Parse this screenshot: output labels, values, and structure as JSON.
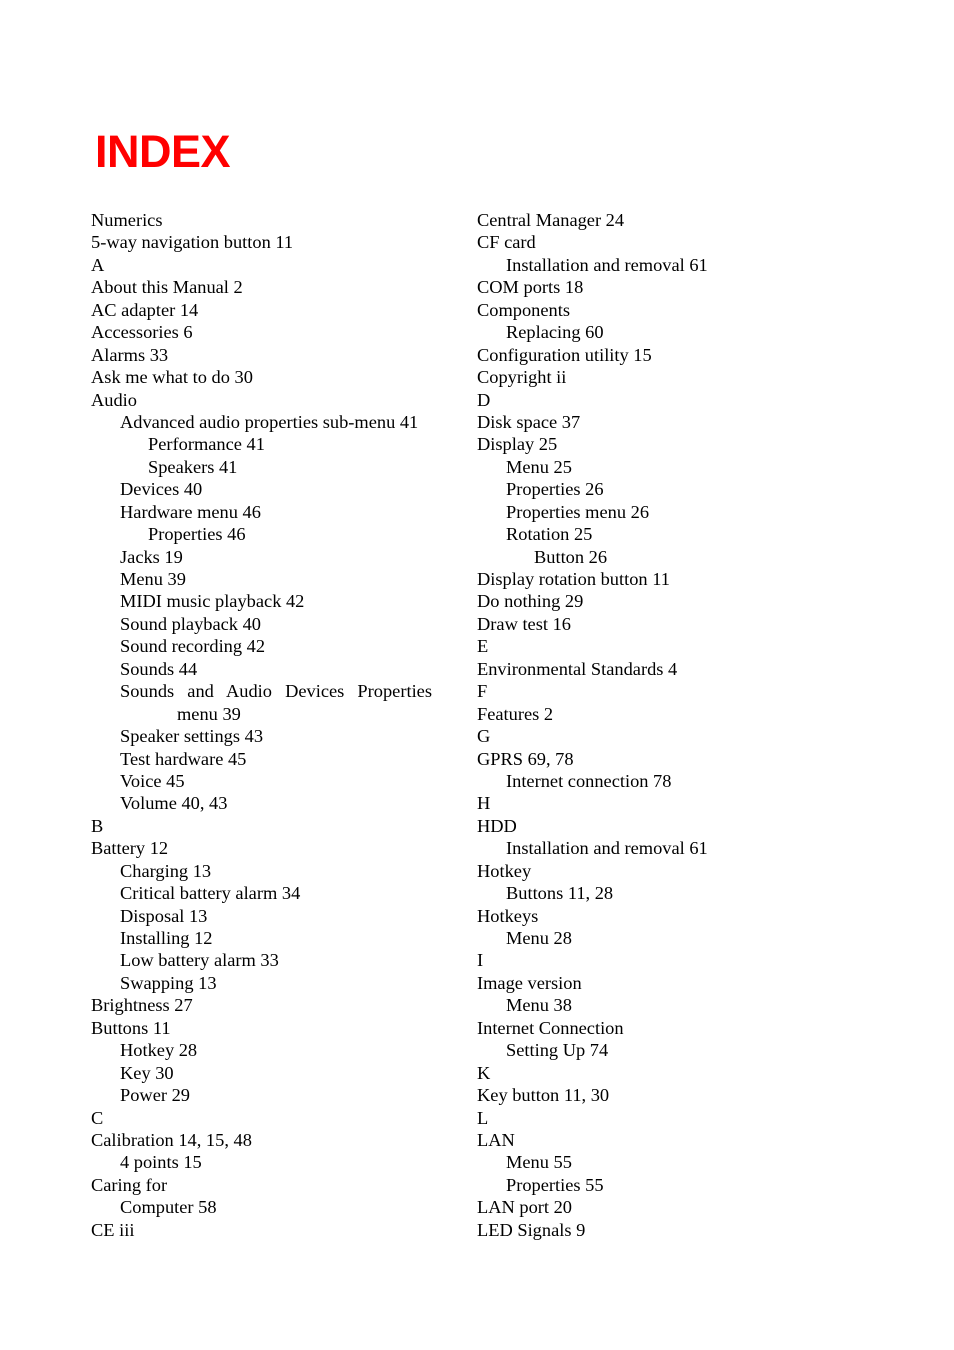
{
  "page": {
    "title": "INDEX",
    "title_color": "#FF0000"
  },
  "index": {
    "left_column": [
      {
        "text": "Numerics",
        "level": 0,
        "kind": "letter"
      },
      {
        "text": "5-way navigation button 11",
        "level": 0,
        "kind": "entry"
      },
      {
        "text": "A",
        "level": 0,
        "kind": "letter"
      },
      {
        "text": "About this Manual 2",
        "level": 0,
        "kind": "entry"
      },
      {
        "text": "AC adapter 14",
        "level": 0,
        "kind": "entry"
      },
      {
        "text": "Accessories 6",
        "level": 0,
        "kind": "entry"
      },
      {
        "text": "Alarms 33",
        "level": 0,
        "kind": "entry"
      },
      {
        "text": "Ask me what to do 30",
        "level": 0,
        "kind": "entry"
      },
      {
        "text": "Audio",
        "level": 0,
        "kind": "entry"
      },
      {
        "text": "Advanced audio properties sub-menu 41",
        "level": 1,
        "kind": "entry"
      },
      {
        "text": "Performance 41",
        "level": 2,
        "kind": "entry"
      },
      {
        "text": "Speakers 41",
        "level": 2,
        "kind": "entry"
      },
      {
        "text": "Devices 40",
        "level": 1,
        "kind": "entry"
      },
      {
        "text": "Hardware menu 46",
        "level": 1,
        "kind": "entry"
      },
      {
        "text": "Properties 46",
        "level": 2,
        "kind": "entry"
      },
      {
        "text": "Jacks 19",
        "level": 1,
        "kind": "entry"
      },
      {
        "text": "Menu 39",
        "level": 1,
        "kind": "entry"
      },
      {
        "text": "MIDI music playback 42",
        "level": 1,
        "kind": "entry"
      },
      {
        "text": "Sound playback 40",
        "level": 1,
        "kind": "entry"
      },
      {
        "text": "Sound recording 42",
        "level": 1,
        "kind": "entry"
      },
      {
        "text": "Sounds 44",
        "level": 1,
        "kind": "entry"
      },
      {
        "text": "Sounds and Audio Devices Properties",
        "level": 1,
        "kind": "justified"
      },
      {
        "text": "menu 39",
        "level": 3,
        "kind": "entry"
      },
      {
        "text": "Speaker settings 43",
        "level": 1,
        "kind": "entry"
      },
      {
        "text": "Test hardware 45",
        "level": 1,
        "kind": "entry"
      },
      {
        "text": "Voice 45",
        "level": 1,
        "kind": "entry"
      },
      {
        "text": "Volume 40, 43",
        "level": 1,
        "kind": "entry"
      },
      {
        "text": "B",
        "level": 0,
        "kind": "letter"
      },
      {
        "text": "Battery 12",
        "level": 0,
        "kind": "entry"
      },
      {
        "text": "Charging 13",
        "level": 1,
        "kind": "entry"
      },
      {
        "text": "Critical battery alarm 34",
        "level": 1,
        "kind": "entry"
      },
      {
        "text": "Disposal 13",
        "level": 1,
        "kind": "entry"
      },
      {
        "text": "Installing 12",
        "level": 1,
        "kind": "entry"
      },
      {
        "text": "Low battery alarm 33",
        "level": 1,
        "kind": "entry"
      },
      {
        "text": "Swapping 13",
        "level": 1,
        "kind": "entry"
      },
      {
        "text": "Brightness 27",
        "level": 0,
        "kind": "entry"
      },
      {
        "text": "Buttons 11",
        "level": 0,
        "kind": "entry"
      },
      {
        "text": "Hotkey 28",
        "level": 1,
        "kind": "entry"
      },
      {
        "text": "Key 30",
        "level": 1,
        "kind": "entry"
      },
      {
        "text": "Power 29",
        "level": 1,
        "kind": "entry"
      },
      {
        "text": "C",
        "level": 0,
        "kind": "letter"
      },
      {
        "text": "Calibration 14, 15, 48",
        "level": 0,
        "kind": "entry"
      },
      {
        "text": "4 points 15",
        "level": 1,
        "kind": "entry"
      },
      {
        "text": "Caring for",
        "level": 0,
        "kind": "entry"
      },
      {
        "text": "Computer 58",
        "level": 1,
        "kind": "entry"
      },
      {
        "text": "CE iii",
        "level": 0,
        "kind": "entry"
      }
    ],
    "right_column": [
      {
        "text": "Central Manager 24",
        "level": 0,
        "kind": "entry"
      },
      {
        "text": "CF card",
        "level": 0,
        "kind": "entry"
      },
      {
        "text": "Installation and removal 61",
        "level": 1,
        "kind": "entry"
      },
      {
        "text": "COM ports 18",
        "level": 0,
        "kind": "entry"
      },
      {
        "text": "Components",
        "level": 0,
        "kind": "entry"
      },
      {
        "text": "Replacing 60",
        "level": 1,
        "kind": "entry"
      },
      {
        "text": "Configuration utility 15",
        "level": 0,
        "kind": "entry"
      },
      {
        "text": "Copyright ii",
        "level": 0,
        "kind": "entry"
      },
      {
        "text": "D",
        "level": 0,
        "kind": "letter"
      },
      {
        "text": "Disk space 37",
        "level": 0,
        "kind": "entry"
      },
      {
        "text": "Display 25",
        "level": 0,
        "kind": "entry"
      },
      {
        "text": "Menu 25",
        "level": 1,
        "kind": "entry"
      },
      {
        "text": "Properties 26",
        "level": 1,
        "kind": "entry"
      },
      {
        "text": "Properties menu 26",
        "level": 1,
        "kind": "entry"
      },
      {
        "text": "Rotation 25",
        "level": 1,
        "kind": "entry"
      },
      {
        "text": "Button 26",
        "level": 2,
        "kind": "entry"
      },
      {
        "text": "Display rotation button 11",
        "level": 0,
        "kind": "entry"
      },
      {
        "text": "Do nothing 29",
        "level": 0,
        "kind": "entry"
      },
      {
        "text": "Draw test 16",
        "level": 0,
        "kind": "entry"
      },
      {
        "text": "E",
        "level": 0,
        "kind": "letter"
      },
      {
        "text": "Environmental Standards 4",
        "level": 0,
        "kind": "entry"
      },
      {
        "text": "F",
        "level": 0,
        "kind": "letter"
      },
      {
        "text": "Features 2",
        "level": 0,
        "kind": "entry"
      },
      {
        "text": "G",
        "level": 0,
        "kind": "letter"
      },
      {
        "text": "GPRS 69, 78",
        "level": 0,
        "kind": "entry"
      },
      {
        "text": "Internet connection 78",
        "level": 1,
        "kind": "entry"
      },
      {
        "text": "H",
        "level": 0,
        "kind": "letter"
      },
      {
        "text": "HDD",
        "level": 0,
        "kind": "entry"
      },
      {
        "text": "Installation and removal 61",
        "level": 1,
        "kind": "entry"
      },
      {
        "text": "Hotkey",
        "level": 0,
        "kind": "entry"
      },
      {
        "text": "Buttons 11, 28",
        "level": 1,
        "kind": "entry"
      },
      {
        "text": "Hotkeys",
        "level": 0,
        "kind": "entry"
      },
      {
        "text": "Menu 28",
        "level": 1,
        "kind": "entry"
      },
      {
        "text": "I",
        "level": 0,
        "kind": "letter"
      },
      {
        "text": "Image version",
        "level": 0,
        "kind": "entry"
      },
      {
        "text": "Menu 38",
        "level": 1,
        "kind": "entry"
      },
      {
        "text": "Internet Connection",
        "level": 0,
        "kind": "entry"
      },
      {
        "text": "Setting Up 74",
        "level": 1,
        "kind": "entry"
      },
      {
        "text": "K",
        "level": 0,
        "kind": "letter"
      },
      {
        "text": "Key button 11, 30",
        "level": 0,
        "kind": "entry"
      },
      {
        "text": "L",
        "level": 0,
        "kind": "letter"
      },
      {
        "text": "LAN",
        "level": 0,
        "kind": "entry"
      },
      {
        "text": "Menu 55",
        "level": 1,
        "kind": "entry"
      },
      {
        "text": "Properties 55",
        "level": 1,
        "kind": "entry"
      },
      {
        "text": "LAN port 20",
        "level": 0,
        "kind": "entry"
      },
      {
        "text": "LED Signals 9",
        "level": 0,
        "kind": "entry"
      }
    ]
  }
}
